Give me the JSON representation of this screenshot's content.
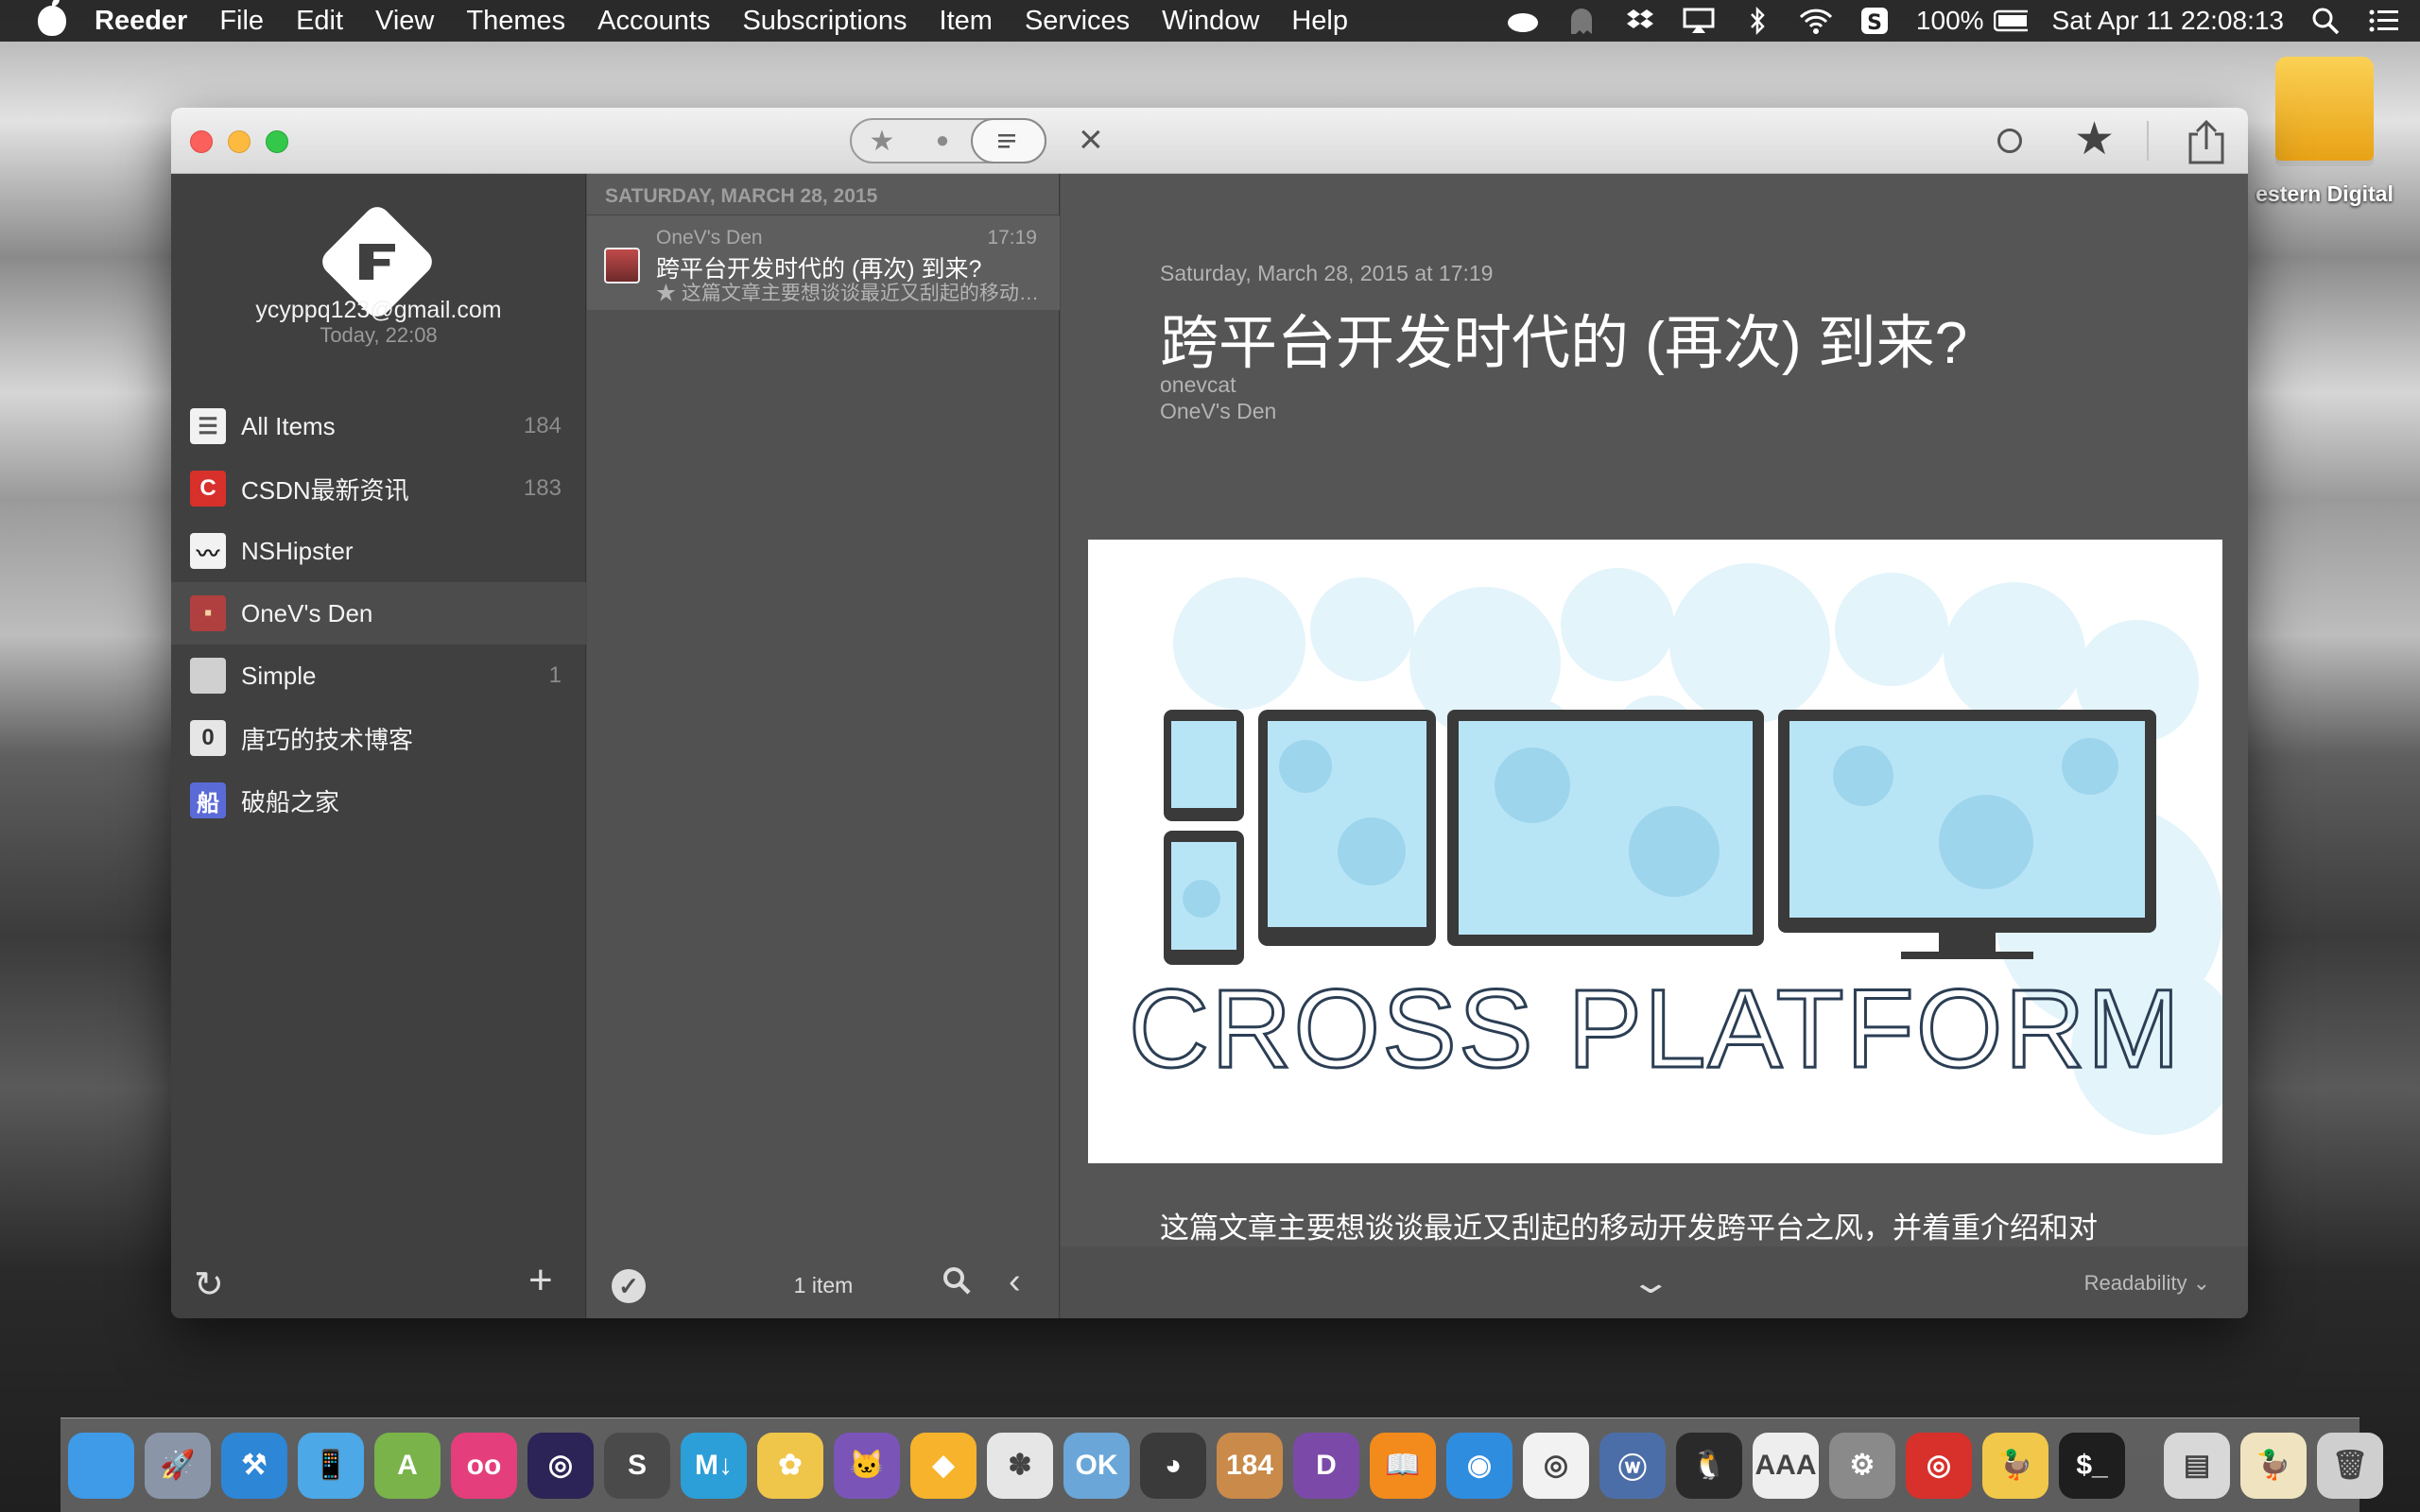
{
  "menubar": {
    "app": "Reeder",
    "menus": [
      "File",
      "Edit",
      "View",
      "Themes",
      "Accounts",
      "Subscriptions",
      "Item",
      "Services",
      "Window",
      "Help"
    ],
    "status": {
      "battery": "100%",
      "datetime": "Sat Apr 11  22:08:13"
    }
  },
  "desktop": {
    "drive_label": "estern Digital"
  },
  "sidebar": {
    "account_email": "ycyppq123@gmail.com",
    "account_time": "Today, 22:08",
    "feeds": [
      {
        "name": "All Items",
        "count": "184",
        "icon_color": "#f2f2f2",
        "glyph": "☰",
        "glyph_color": "#555"
      },
      {
        "name": "CSDN最新资讯",
        "count": "183",
        "icon_color": "#d8302b",
        "glyph": "C",
        "glyph_color": "#fff"
      },
      {
        "name": "NSHipster",
        "count": "",
        "icon_color": "#f2f2f2",
        "glyph": "〰",
        "glyph_color": "#222"
      },
      {
        "name": "OneV's Den",
        "count": "",
        "icon_color": "#b04040",
        "glyph": "▪",
        "glyph_color": "#f3d2a0"
      },
      {
        "name": "Simple",
        "count": "1",
        "icon_color": "#d0d0d0",
        "glyph": "",
        "glyph_color": "#777"
      },
      {
        "name": "唐巧的技术博客",
        "count": "",
        "icon_color": "#e6e6e6",
        "glyph": "0",
        "glyph_color": "#333"
      },
      {
        "name": "破船之家",
        "count": "",
        "icon_color": "#5a6bd8",
        "glyph": "船",
        "glyph_color": "#fff"
      }
    ]
  },
  "list": {
    "date_header": "SATURDAY, MARCH 28, 2015",
    "item_count": "1 item",
    "items": [
      {
        "source": "OneV's Den",
        "time": "17:19",
        "title": "跨平台开发时代的 (再次) 到来?",
        "summary": "★ 这篇文章主要想谈谈最近又刮起的移动开发跨平台之风，并着重介绍和对"
      }
    ]
  },
  "reader": {
    "date": "Saturday, March 28, 2015 at 17:19",
    "title": "跨平台开发时代的 (再次) 到来?",
    "author": "onevcat",
    "feed": "OneV's Den",
    "image_text": "CROSS PLATFORM",
    "body": "这篇文章主要想谈谈最近又刮起的移动开发跨平台之风，并着重介绍和对",
    "view_mode": "Readability"
  },
  "dock": {
    "apps": [
      {
        "name": "finder",
        "color": "#3f9ae8",
        "glyph": ""
      },
      {
        "name": "launchpad",
        "color": "#8a96a8",
        "glyph": "🚀"
      },
      {
        "name": "xcode",
        "color": "#2d86d6",
        "glyph": "⚒"
      },
      {
        "name": "simulator",
        "color": "#4ca8e6",
        "glyph": "📱"
      },
      {
        "name": "android-studio",
        "color": "#79b34a",
        "glyph": "A"
      },
      {
        "name": "flickr",
        "color": "#e43e7c",
        "glyph": "oo"
      },
      {
        "name": "eclipse",
        "color": "#2c2456",
        "glyph": "◎"
      },
      {
        "name": "sublime-text",
        "color": "#4a4a4a",
        "glyph": "S"
      },
      {
        "name": "mou",
        "color": "#2c9fd8",
        "glyph": "M↓"
      },
      {
        "name": "cornerstone",
        "color": "#f0c64a",
        "glyph": "✿"
      },
      {
        "name": "github",
        "color": "#7a55b7",
        "glyph": "🐱"
      },
      {
        "name": "sketch",
        "color": "#f7b32b",
        "glyph": "◆"
      },
      {
        "name": "pinwheel",
        "color": "#e6e6e6",
        "glyph": "✽"
      },
      {
        "name": "preview",
        "color": "#6aa6d8",
        "glyph": "OK"
      },
      {
        "name": "color-picker",
        "color": "#3a3a3a",
        "glyph": "◕"
      },
      {
        "name": "reeder-box",
        "color": "#c98a4a",
        "glyph": "184"
      },
      {
        "name": "dash",
        "color": "#7b4aa8",
        "glyph": "D"
      },
      {
        "name": "ibooks",
        "color": "#f28b1c",
        "glyph": "📖"
      },
      {
        "name": "safari",
        "color": "#2f8de0",
        "glyph": "◉"
      },
      {
        "name": "chrome",
        "color": "#f2f2f2",
        "glyph": "◎"
      },
      {
        "name": "weibo",
        "color": "#4c6ea8",
        "glyph": "ⓦ"
      },
      {
        "name": "qq",
        "color": "#2a2a2a",
        "glyph": "🐧"
      },
      {
        "name": "font-book",
        "color": "#eeeeee",
        "glyph": "AAA"
      },
      {
        "name": "system-preferences",
        "color": "#8a8a8a",
        "glyph": "⚙"
      },
      {
        "name": "netease-music",
        "color": "#d8302b",
        "glyph": "◎"
      },
      {
        "name": "cyberduck",
        "color": "#f2c84a",
        "glyph": "🦆"
      },
      {
        "name": "terminal",
        "color": "#1e1e1e",
        "glyph": "$_"
      },
      {
        "name": "downloads-stack",
        "color": "#d8d8d8",
        "glyph": "▤"
      },
      {
        "name": "document-stack",
        "color": "#f0e4c0",
        "glyph": "🦆"
      },
      {
        "name": "trash",
        "color": "#cfcfcf",
        "glyph": "🗑"
      }
    ]
  }
}
